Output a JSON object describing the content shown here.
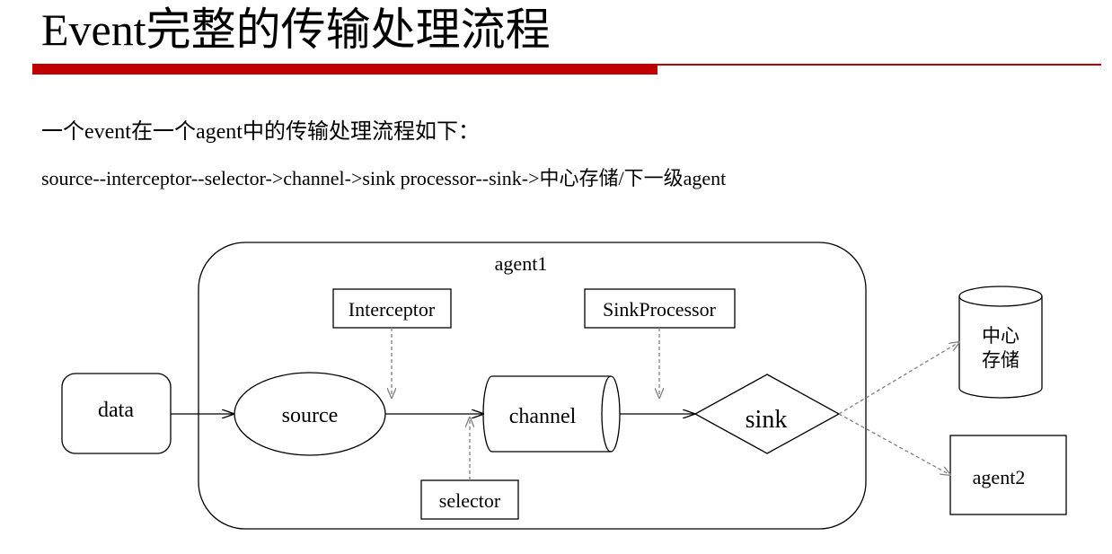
{
  "title": "Event完整的传输处理流程",
  "intro": "一个event在一个agent中的传输处理流程如下：",
  "flow_text": "source--interceptor--selector->channel->sink processor--sink->中心存储/下一级agent",
  "diagram": {
    "container_label": "agent1",
    "nodes": {
      "data": "data",
      "source": "source",
      "channel": "channel",
      "sink": "sink",
      "interceptor": "Interceptor",
      "sink_processor": "SinkProcessor",
      "selector": "selector",
      "storage_line1": "中心",
      "storage_line2": "存储",
      "agent2": "agent2"
    }
  },
  "colors": {
    "accent": "#c00000",
    "line": "#000000",
    "dashed": "#808080"
  }
}
